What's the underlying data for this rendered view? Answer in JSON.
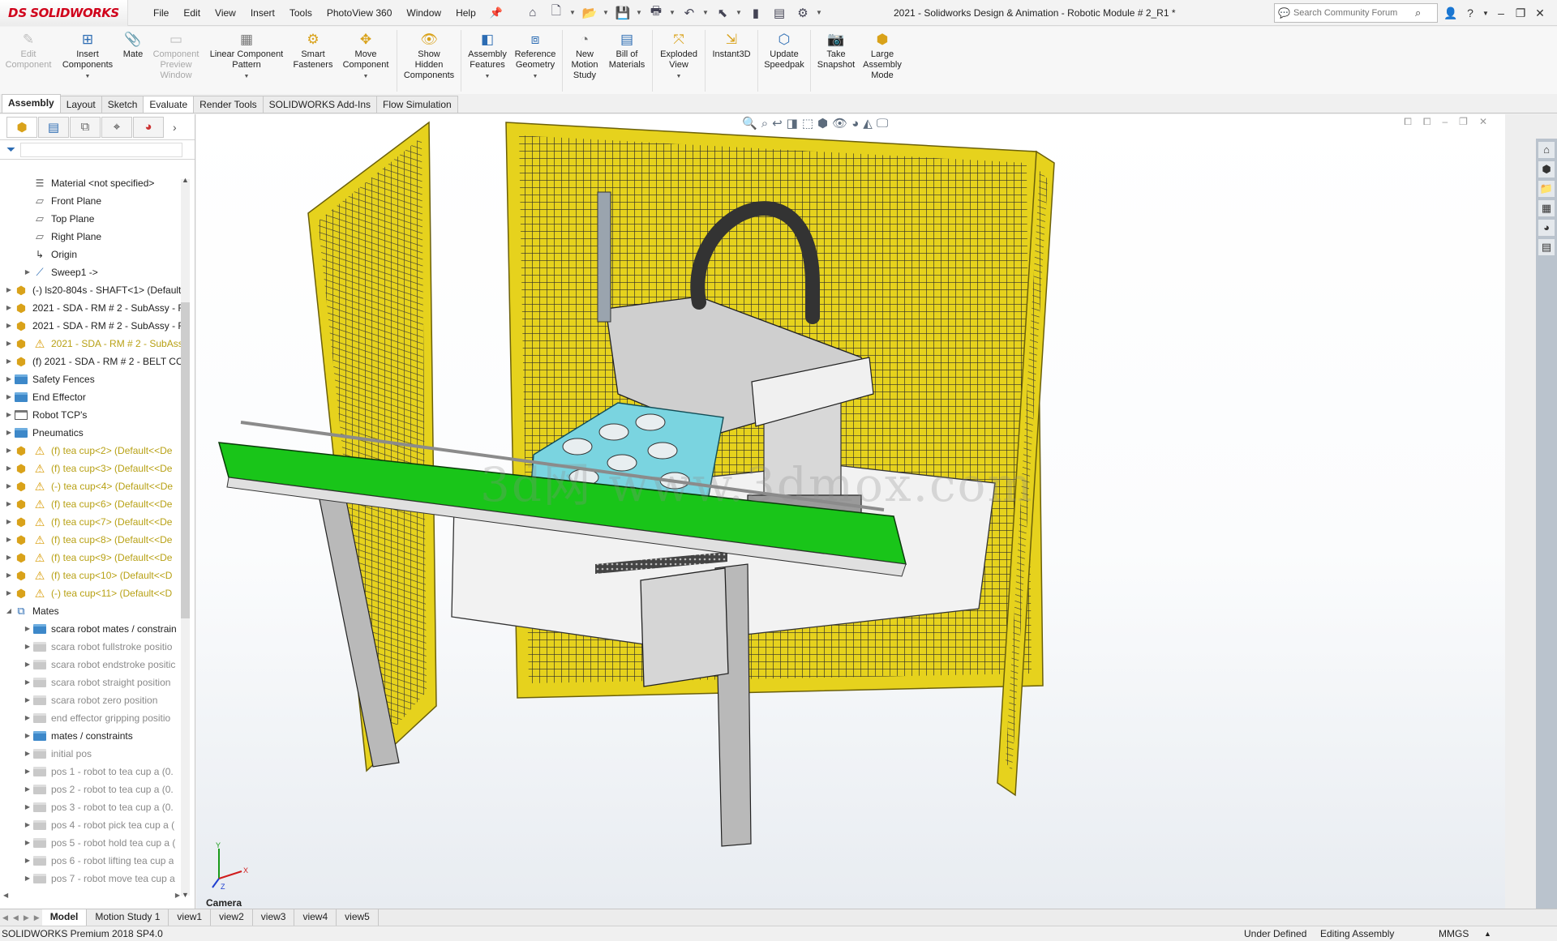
{
  "app": {
    "logo_mark": "DS",
    "logo_text": "SOLIDWORKS",
    "document_title": "2021 - Solidworks Design & Animation - Robotic Module # 2_R1 *"
  },
  "menu": [
    "File",
    "Edit",
    "View",
    "Insert",
    "Tools",
    "PhotoView 360",
    "Window",
    "Help"
  ],
  "search": {
    "placeholder": "Search Community Forum"
  },
  "ribbon": [
    {
      "label": "Edit Component",
      "icon": "edit-component-icon",
      "enabled": false
    },
    {
      "label": "Insert Components",
      "icon": "insert-components-icon",
      "enabled": true
    },
    {
      "label": "Mate",
      "icon": "mate-icon",
      "enabled": true
    },
    {
      "label": "Component Preview Window",
      "icon": "preview-window-icon",
      "enabled": false
    },
    {
      "label": "Linear Component Pattern",
      "icon": "linear-pattern-icon",
      "enabled": true
    },
    {
      "label": "Smart Fasteners",
      "icon": "smart-fasteners-icon",
      "enabled": true
    },
    {
      "label": "Move Component",
      "icon": "move-component-icon",
      "enabled": true
    },
    {
      "label": "Show Hidden Components",
      "icon": "show-hidden-icon",
      "enabled": true
    },
    {
      "label": "Assembly Features",
      "icon": "assembly-features-icon",
      "enabled": true
    },
    {
      "label": "Reference Geometry",
      "icon": "reference-geometry-icon",
      "enabled": true
    },
    {
      "label": "New Motion Study",
      "icon": "motion-study-icon",
      "enabled": true
    },
    {
      "label": "Bill of Materials",
      "icon": "bom-icon",
      "enabled": true
    },
    {
      "label": "Exploded View",
      "icon": "exploded-view-icon",
      "enabled": true
    },
    {
      "label": "Instant3D",
      "icon": "instant3d-icon",
      "enabled": true
    },
    {
      "label": "Update Speedpak",
      "icon": "speedpak-icon",
      "enabled": true
    },
    {
      "label": "Take Snapshot",
      "icon": "snapshot-icon",
      "enabled": true
    },
    {
      "label": "Large Assembly Mode",
      "icon": "large-assembly-icon",
      "enabled": true
    }
  ],
  "command_tabs": [
    "Assembly",
    "Layout",
    "Sketch",
    "Evaluate",
    "Render Tools",
    "SOLIDWORKS Add-Ins",
    "Flow Simulation"
  ],
  "active_command_tab": "Assembly",
  "tree": [
    {
      "label": "Material <not specified>",
      "icon": "material-icon",
      "level": 1,
      "expand": false,
      "style": "normal"
    },
    {
      "label": "Front Plane",
      "icon": "plane-icon",
      "level": 1,
      "expand": false,
      "style": "normal"
    },
    {
      "label": "Top Plane",
      "icon": "plane-icon",
      "level": 1,
      "expand": false,
      "style": "normal"
    },
    {
      "label": "Right Plane",
      "icon": "plane-icon",
      "level": 1,
      "expand": false,
      "style": "normal"
    },
    {
      "label": "Origin",
      "icon": "origin-icon",
      "level": 1,
      "expand": false,
      "style": "normal"
    },
    {
      "label": "Sweep1 ->",
      "icon": "sweep-icon",
      "level": 1,
      "expand": true,
      "style": "normal"
    },
    {
      "label": "(-) ls20-804s - SHAFT<1> (Default",
      "icon": "assembly-icon",
      "level": 0,
      "expand": true,
      "style": "normal"
    },
    {
      "label": "2021 - SDA - RM # 2 - SubAssy - F",
      "icon": "assembly-icon",
      "level": 0,
      "expand": true,
      "style": "normal"
    },
    {
      "label": "2021 - SDA - RM # 2 - SubAssy - F",
      "icon": "assembly-icon",
      "level": 0,
      "expand": true,
      "style": "normal"
    },
    {
      "label": "2021 - SDA - RM # 2 - SubAss",
      "icon": "warning-icon",
      "level": 0,
      "expand": true,
      "style": "warn"
    },
    {
      "label": "(f) 2021 - SDA - RM # 2 - BELT CC",
      "icon": "assembly-icon",
      "level": 0,
      "expand": true,
      "style": "normal"
    },
    {
      "label": "Safety Fences",
      "icon": "folder-icon",
      "level": 0,
      "expand": true,
      "style": "normal"
    },
    {
      "label": "End Effector",
      "icon": "folder-icon",
      "level": 0,
      "expand": true,
      "style": "normal"
    },
    {
      "label": "Robot TCP's",
      "icon": "folder-empty-icon",
      "level": 0,
      "expand": true,
      "style": "normal"
    },
    {
      "label": "Pneumatics",
      "icon": "folder-icon",
      "level": 0,
      "expand": true,
      "style": "normal"
    },
    {
      "label": "(f) tea cup<2> (Default<<De",
      "icon": "warning-icon",
      "level": 0,
      "expand": true,
      "style": "warn"
    },
    {
      "label": "(f) tea cup<3> (Default<<De",
      "icon": "warning-icon",
      "level": 0,
      "expand": true,
      "style": "warn"
    },
    {
      "label": "(-) tea cup<4> (Default<<De",
      "icon": "warning-icon",
      "level": 0,
      "expand": true,
      "style": "warn"
    },
    {
      "label": "(f) tea cup<6> (Default<<De",
      "icon": "warning-icon",
      "level": 0,
      "expand": true,
      "style": "warn"
    },
    {
      "label": "(f) tea cup<7> (Default<<De",
      "icon": "warning-icon",
      "level": 0,
      "expand": true,
      "style": "warn"
    },
    {
      "label": "(f) tea cup<8> (Default<<De",
      "icon": "warning-icon",
      "level": 0,
      "expand": true,
      "style": "warn"
    },
    {
      "label": "(f) tea cup<9> (Default<<De",
      "icon": "warning-icon",
      "level": 0,
      "expand": true,
      "style": "warn"
    },
    {
      "label": "(f) tea cup<10> (Default<<D",
      "icon": "warning-icon",
      "level": 0,
      "expand": true,
      "style": "warn"
    },
    {
      "label": "(-) tea cup<11> (Default<<D",
      "icon": "warning-icon",
      "level": 0,
      "expand": true,
      "style": "warn"
    },
    {
      "label": "Mates",
      "icon": "mates-icon",
      "level": 0,
      "expand": "open",
      "style": "normal"
    },
    {
      "label": "scara robot mates / constrain",
      "icon": "folder-icon",
      "level": 1,
      "expand": true,
      "style": "normal"
    },
    {
      "label": "scara robot fullstroke positio",
      "icon": "folder-gray-icon",
      "level": 1,
      "expand": true,
      "style": "dim"
    },
    {
      "label": "scara robot endstroke positic",
      "icon": "folder-gray-icon",
      "level": 1,
      "expand": true,
      "style": "dim"
    },
    {
      "label": "scara robot straight position",
      "icon": "folder-gray-icon",
      "level": 1,
      "expand": true,
      "style": "dim"
    },
    {
      "label": "scara robot zero position",
      "icon": "folder-gray-icon",
      "level": 1,
      "expand": true,
      "style": "dim"
    },
    {
      "label": "end effector gripping positio",
      "icon": "folder-gray-icon",
      "level": 1,
      "expand": true,
      "style": "dim"
    },
    {
      "label": "mates / constraints",
      "icon": "folder-icon",
      "level": 1,
      "expand": true,
      "style": "normal"
    },
    {
      "label": "initial pos",
      "icon": "folder-gray-icon",
      "level": 1,
      "expand": true,
      "style": "dim"
    },
    {
      "label": "pos 1 - robot to tea cup a (0.",
      "icon": "folder-gray-icon",
      "level": 1,
      "expand": true,
      "style": "dim"
    },
    {
      "label": "pos 2 - robot to tea cup a (0.",
      "icon": "folder-gray-icon",
      "level": 1,
      "expand": true,
      "style": "dim"
    },
    {
      "label": "pos 3 - robot to tea cup a (0.",
      "icon": "folder-gray-icon",
      "level": 1,
      "expand": true,
      "style": "dim"
    },
    {
      "label": "pos 4 - robot pick tea cup a (",
      "icon": "folder-gray-icon",
      "level": 1,
      "expand": true,
      "style": "dim"
    },
    {
      "label": "pos 5 - robot hold tea cup a (",
      "icon": "folder-gray-icon",
      "level": 1,
      "expand": true,
      "style": "dim"
    },
    {
      "label": "pos 6 - robot lifting tea cup a",
      "icon": "folder-gray-icon",
      "level": 1,
      "expand": true,
      "style": "dim"
    },
    {
      "label": "pos 7 - robot move tea cup a",
      "icon": "folder-gray-icon",
      "level": 1,
      "expand": true,
      "style": "dim"
    }
  ],
  "viewport": {
    "watermark": "3d网 www.3dmox.com",
    "camera_label": "Camera",
    "triad": {
      "x": "X",
      "y": "Y",
      "z": "Z"
    }
  },
  "bottom_tabs": [
    "Model",
    "Motion Study 1",
    "view1",
    "view2",
    "view3",
    "view4",
    "view5"
  ],
  "active_bottom_tab": "Model",
  "status": {
    "product": "SOLIDWORKS Premium 2018 SP4.0",
    "definition": "Under Defined",
    "mode": "Editing Assembly",
    "units": "MMGS",
    "units_arrow": "▲"
  },
  "colors": {
    "brand_red": "#d0021b",
    "fence_yellow": "#e6d21d",
    "belt_green": "#19c519",
    "tray_cyan": "#7ad4e0",
    "folder_blue": "#3d88c9",
    "warning": "#d89c06"
  }
}
